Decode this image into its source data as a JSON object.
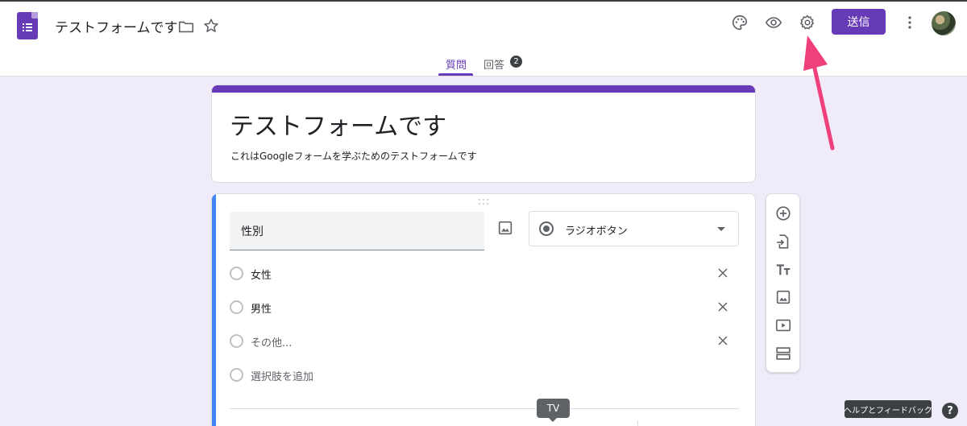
{
  "header": {
    "doc_title": "テストフォームです",
    "send_label": "送信",
    "icons": [
      "forms-logo-icon",
      "folder-icon",
      "star-icon",
      "palette-icon",
      "preview-eye-icon",
      "settings-gear-icon",
      "more-vert-icon"
    ],
    "accent_color": "#673ab7"
  },
  "tabs": {
    "questions": "質問",
    "responses": "回答",
    "responses_count": "2"
  },
  "form": {
    "title": "テストフォームです",
    "description": "これはGoogleフォームを学ぶためのテストフォームです"
  },
  "question": {
    "title": "性別",
    "type_label": "ラジオボタン",
    "options": [
      {
        "label": "女性"
      },
      {
        "label": "男性"
      },
      {
        "label": "その他..."
      }
    ],
    "add_option": "選択肢を追加"
  },
  "side_toolbar": {
    "icons": [
      "add-question-icon",
      "import-questions-icon",
      "add-title-icon",
      "add-image-icon",
      "add-video-icon",
      "add-section-icon"
    ]
  },
  "tooltip": "TV",
  "footer": {
    "help_feedback": "ヘルプとフィードバック",
    "help_icon_label": "?"
  }
}
